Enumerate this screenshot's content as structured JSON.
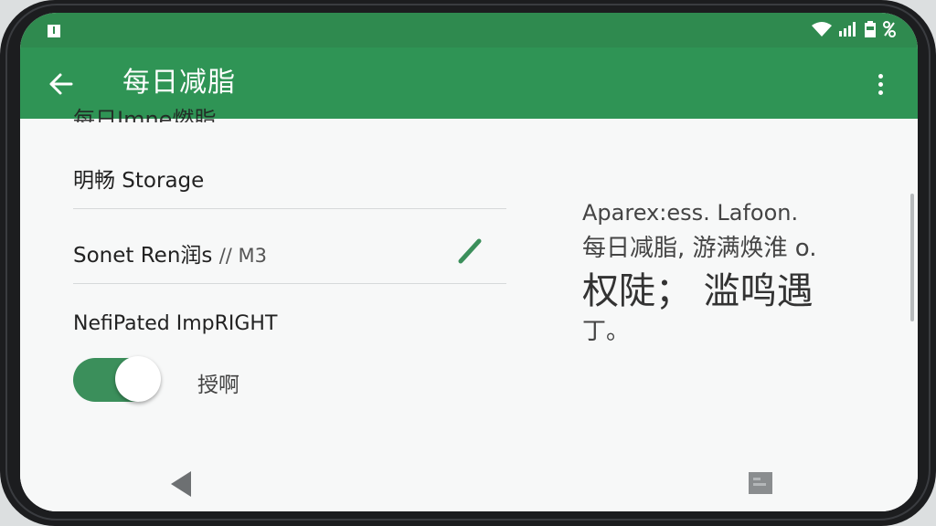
{
  "status_bar": {
    "left_icon": "status-square-icon",
    "right_icons": [
      "wifi-icon",
      "signal-icon",
      "battery-icon",
      "data-icon"
    ]
  },
  "app_bar": {
    "title": "每日减脂",
    "back_icon": "arrow-left-icon",
    "more_icon": "more-vertical-icon"
  },
  "content": {
    "partial_row": "每日Imne燃脂",
    "storage_row": "明畅 Storage",
    "sonet_row": {
      "label": "Sonet Ren润s",
      "suffix": "// M3"
    },
    "notif_row": "NefiPated ImpRIGHT",
    "toggle": {
      "state": true,
      "label": "授啊"
    },
    "right_text": {
      "line1": "Aparex:ess. Lafoon.",
      "line2": "每日减脂, 游满焕淮 o.",
      "line3": "权陡；  滥鸣遇",
      "line4": "丁。"
    }
  },
  "colors": {
    "status_bar": "#2f8a4f",
    "app_bar": "#2f9455",
    "accent": "#3b8f5b",
    "background": "#f7f8f8"
  }
}
